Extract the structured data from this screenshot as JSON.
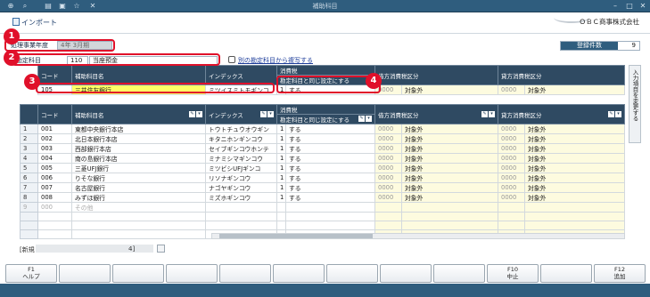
{
  "window": {
    "title": "補助科目",
    "toolbar_icons": [
      "add-icon",
      "search-icon",
      "print-icon",
      "preview-icon",
      "favorites-icon",
      "delete-icon"
    ],
    "controls": [
      "minimize-icon",
      "maximize-icon",
      "close-icon"
    ]
  },
  "menu": {
    "import_label": "インポート",
    "company": "ＯＢＣ商事株式会社"
  },
  "fields": {
    "fiscal_year_label": "処理事業年度",
    "fiscal_year_value": "4年 3月期",
    "account_label": "勘定科目",
    "account_code": "110",
    "account_name": "当座預金",
    "copy_link": "別の勘定科目から複写する"
  },
  "count": {
    "label": "登録件数",
    "value": "9"
  },
  "callouts": [
    "1",
    "2",
    "3",
    "4"
  ],
  "headers": {
    "code": "コード",
    "name": "補助科目名",
    "index": "インデックス",
    "tax_group": "消費税",
    "same_as_account": "勘定科目と同じ設定にする",
    "debit_tax": "借方消費税区分",
    "credit_tax": "貸方消費税区分"
  },
  "entry_row": {
    "code": "105",
    "name": "三井住友銀行",
    "index": "ミツイスミトモギンコ",
    "same_no": "1",
    "same_label": "する",
    "debit_code": "0000",
    "debit_label": "対象外",
    "credit_code": "0000",
    "credit_label": "対象外"
  },
  "rows": [
    {
      "no": "1",
      "code": "001",
      "name": "東都中央銀行本店",
      "index": "トウトチュウオウギン",
      "same_no": "1",
      "same_label": "する",
      "debit_code": "0000",
      "debit_label": "対象外",
      "credit_code": "0000",
      "credit_label": "対象外"
    },
    {
      "no": "2",
      "code": "002",
      "name": "北日本銀行本店",
      "index": "キタニホンギンコウ",
      "same_no": "1",
      "same_label": "する",
      "debit_code": "0000",
      "debit_label": "対象外",
      "credit_code": "0000",
      "credit_label": "対象外"
    },
    {
      "no": "3",
      "code": "003",
      "name": "西部銀行本店",
      "index": "セイブギンコウホンテ",
      "same_no": "1",
      "same_label": "する",
      "debit_code": "0000",
      "debit_label": "対象外",
      "credit_code": "0000",
      "credit_label": "対象外"
    },
    {
      "no": "4",
      "code": "004",
      "name": "南の島銀行本店",
      "index": "ミナミシマギンコウ",
      "same_no": "1",
      "same_label": "する",
      "debit_code": "0000",
      "debit_label": "対象外",
      "credit_code": "0000",
      "credit_label": "対象外"
    },
    {
      "no": "5",
      "code": "005",
      "name": "三菱UFJ銀行",
      "index": "ミツビシUFJギンコ",
      "same_no": "1",
      "same_label": "する",
      "debit_code": "0000",
      "debit_label": "対象外",
      "credit_code": "0000",
      "credit_label": "対象外"
    },
    {
      "no": "6",
      "code": "006",
      "name": "りそな銀行",
      "index": "リソナギンコウ",
      "same_no": "1",
      "same_label": "する",
      "debit_code": "0000",
      "debit_label": "対象外",
      "credit_code": "0000",
      "credit_label": "対象外"
    },
    {
      "no": "7",
      "code": "007",
      "name": "名古屋銀行",
      "index": "ナゴヤギンコウ",
      "same_no": "1",
      "same_label": "する",
      "debit_code": "0000",
      "debit_label": "対象外",
      "credit_code": "0000",
      "credit_label": "対象外"
    },
    {
      "no": "8",
      "code": "008",
      "name": "みずほ銀行",
      "index": "ミズホギンコウ",
      "same_no": "1",
      "same_label": "する",
      "debit_code": "0000",
      "debit_label": "対象外",
      "credit_code": "0000",
      "credit_label": "対象外"
    },
    {
      "no": "9",
      "code": "000",
      "name": "その他",
      "index": "",
      "same_no": "",
      "same_label": "",
      "debit_code": "",
      "debit_label": "",
      "credit_code": "",
      "credit_label": ""
    }
  ],
  "side_panel": {
    "label": "入力項目を変更する"
  },
  "new_row": {
    "label": "[新規",
    "suffix": "4]"
  },
  "fkeys": [
    {
      "key": "F1",
      "label": "ヘルプ"
    },
    {
      "key": "",
      "label": ""
    },
    {
      "key": "",
      "label": ""
    },
    {
      "key": "",
      "label": ""
    },
    {
      "key": "",
      "label": ""
    },
    {
      "key": "",
      "label": ""
    },
    {
      "key": "",
      "label": ""
    },
    {
      "key": "",
      "label": ""
    },
    {
      "key": "",
      "label": ""
    },
    {
      "key": "F10",
      "label": "中止"
    },
    {
      "key": "",
      "label": ""
    },
    {
      "key": "F12",
      "label": "追加"
    }
  ],
  "colors": {
    "header": "#2f4a62",
    "accent": "#2f5d7e",
    "highlight": "#ffff66",
    "callout": "#e0102a"
  }
}
